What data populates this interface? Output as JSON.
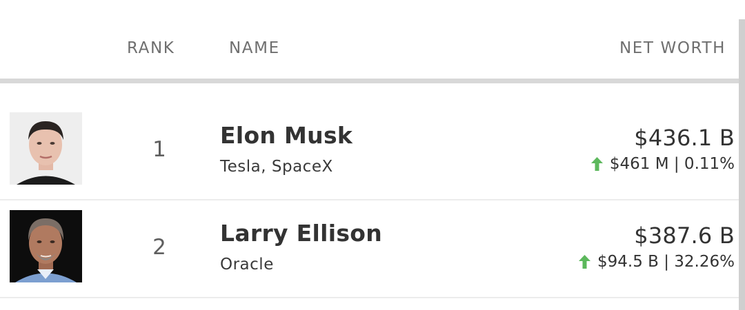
{
  "header": {
    "rank_label": "RANK",
    "name_label": "NAME",
    "net_worth_label": "NET WORTH"
  },
  "colors": {
    "up_arrow": "#5cb85c",
    "divider": "#d8d8d8"
  },
  "rows": [
    {
      "rank": "1",
      "name": "Elon Musk",
      "source": "Tesla, SpaceX",
      "net_worth": "$436.1 B",
      "change": "$461 M | 0.11%",
      "change_direction": "up",
      "avatar_icon": "person-photo"
    },
    {
      "rank": "2",
      "name": "Larry Ellison",
      "source": "Oracle",
      "net_worth": "$387.6 B",
      "change": "$94.5 B | 32.26%",
      "change_direction": "up",
      "avatar_icon": "person-photo"
    }
  ]
}
